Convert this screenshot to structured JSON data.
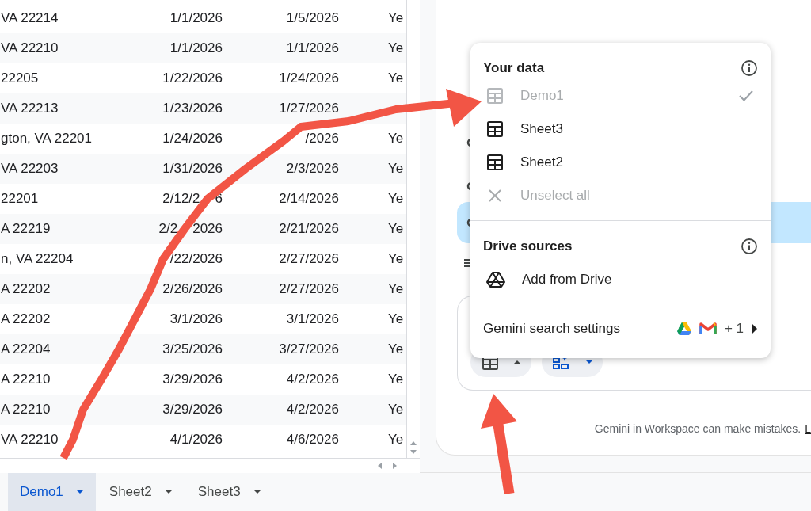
{
  "sheet": {
    "rows": [
      {
        "address": "VA 22214",
        "start": "1/1/2026",
        "end": "1/5/2026",
        "column_4": "Ye"
      },
      {
        "address": "VA 22210",
        "start": "1/1/2026",
        "end": "1/1/2026",
        "column_4": "Ye"
      },
      {
        "address": "22205",
        "start": "1/22/2026",
        "end": "1/24/2026",
        "column_4": "Ye"
      },
      {
        "address": "VA 22213",
        "start": "1/23/2026",
        "end": "1/27/2026"
      },
      {
        "address": "gton, VA 22201",
        "start": "1/24/2026",
        "end": "/2026",
        "column_4": "Ye"
      },
      {
        "address": "VA 22203",
        "start": "1/31/2026",
        "end": "2/3/2026",
        "column_4": "Ye"
      },
      {
        "address": "22201",
        "start": [
          "2/12/2",
          "6"
        ],
        "end": "2/14/2026",
        "column_4": "Ye"
      },
      {
        "address": "A 22219",
        "start": [
          "2/2",
          "2026"
        ],
        "end": "2/21/2026",
        "column_4": "Ye"
      },
      {
        "address": "n, VA 22204",
        "start": "/22/2026",
        "end": "2/27/2026",
        "column_4": "Ye"
      },
      {
        "address": "A 22202",
        "start": "2/26/2026",
        "end": "2/27/2026",
        "column_4": "Ye"
      },
      {
        "address": "A 22202",
        "start": "3/1/2026",
        "end": "3/1/2026",
        "column_4": "Ye"
      },
      {
        "address": "A 22204",
        "start": "3/25/2026",
        "end": "3/27/2026",
        "column_4": "Ye"
      },
      {
        "address": "A 22210",
        "start": "3/29/2026",
        "end": "4/2/2026",
        "column_4": "Ye"
      },
      {
        "address": "A 22210",
        "start": "3/29/2026",
        "end": "4/2/2026",
        "column_4": "Ye"
      },
      {
        "address": "VA 22210",
        "start": "4/1/2026",
        "end": "4/6/2026",
        "column_4": "Ye"
      }
    ]
  },
  "sheet_tabs": [
    {
      "label": "Demo1",
      "selected": true
    },
    {
      "label": "Sheet2",
      "selected": false
    },
    {
      "label": "Sheet3",
      "selected": false
    }
  ],
  "sources_menu": {
    "sections": [
      {
        "title": "Your data",
        "items": [
          {
            "kind": "sheet",
            "label": "Demo1",
            "disabled": true,
            "checked": true
          },
          {
            "kind": "sheet",
            "label": "Sheet3",
            "disabled": false,
            "checked": false
          },
          {
            "kind": "sheet",
            "label": "Sheet2",
            "disabled": false,
            "checked": false
          },
          {
            "kind": "unselect",
            "label": "Unselect all",
            "disabled": true,
            "checked": false
          }
        ]
      },
      {
        "title": "Drive sources",
        "items": [
          {
            "kind": "drive",
            "label": "Add from Drive",
            "disabled": false,
            "checked": false
          }
        ]
      }
    ],
    "settings": {
      "label": "Gemini search settings",
      "more": "+ 1"
    }
  },
  "composer": {
    "chips": [
      {
        "kind": "sources",
        "expanded": true
      },
      {
        "kind": "tools",
        "expanded": false
      }
    ]
  },
  "disclaimer": {
    "text": "Gemini in Workspace can make mistakes.",
    "link": "L"
  }
}
